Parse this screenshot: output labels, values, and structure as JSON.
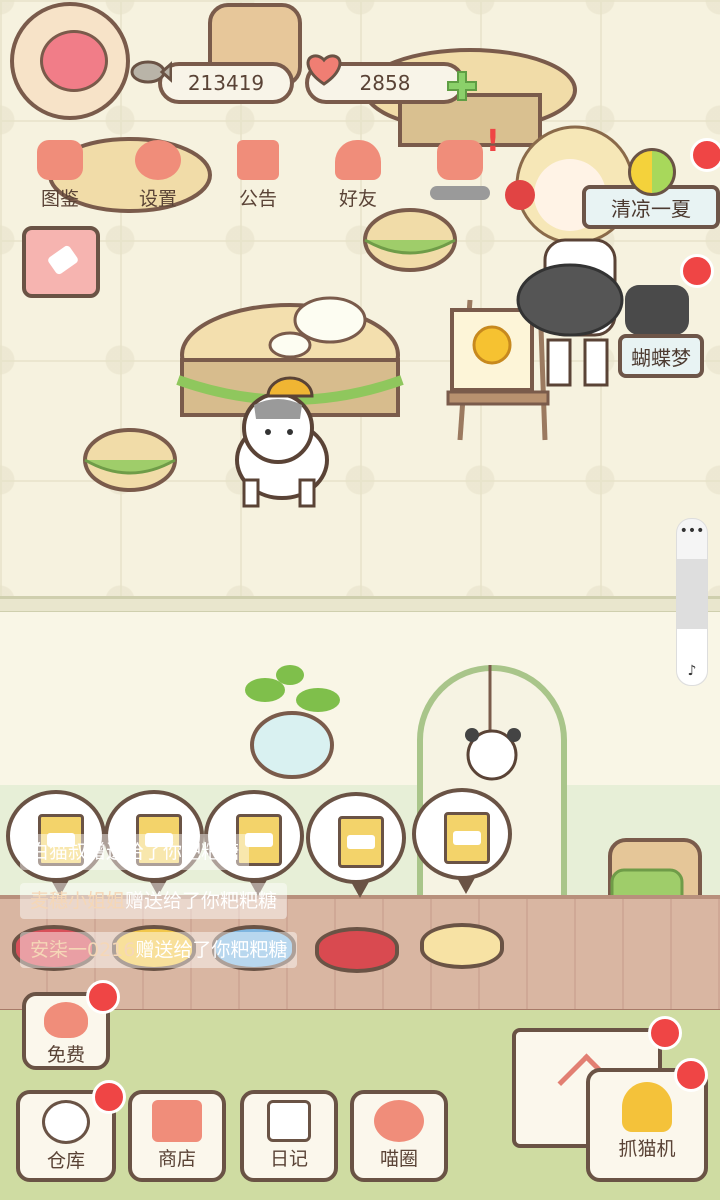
{
  "currency": {
    "fish": "213419",
    "hearts": "2858"
  },
  "top_menu": [
    {
      "label": "图鉴"
    },
    {
      "label": "设置"
    },
    {
      "label": "公告"
    },
    {
      "label": "好友"
    }
  ],
  "events": {
    "summer": "清凉一夏",
    "butterfly": "蝴蝶梦"
  },
  "gift_log": [
    {
      "name": "白猫叔",
      "text": "赠送给了你粑粑糖"
    },
    {
      "name": "麦穗小姐姐",
      "text": "赠送给了你粑粑糖"
    },
    {
      "name": "安柒一0216",
      "text": "赠送给了你粑粑糖"
    }
  ],
  "free_button": "免费",
  "bottom_nav": [
    {
      "label": "仓库"
    },
    {
      "label": "商店"
    },
    {
      "label": "日记"
    },
    {
      "label": "喵圈"
    }
  ],
  "claw_machine": "抓猫机",
  "colors": {
    "badge": "#ef4545",
    "outline": "#6a5345",
    "accent": "#f08d7a"
  }
}
